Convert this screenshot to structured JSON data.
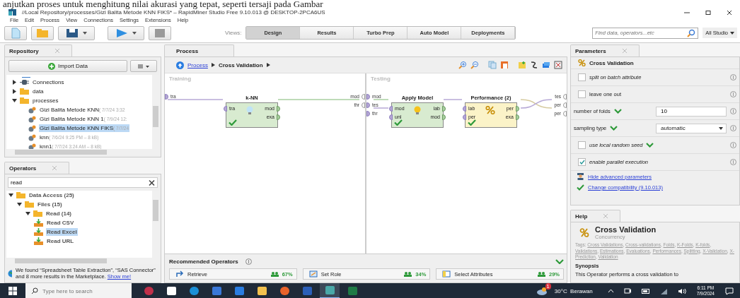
{
  "document_text": "anjutkan proses untuk menghitung nilai akurasi yang tepat, seperti tersaji pada Gambar",
  "window": {
    "title": "//Local Repository/processes/Gizi Balita Metode KNN FIKS* – RapidMiner Studio Free 9.10.013 @ DESKTOP-2PCA6US"
  },
  "menu": [
    "File",
    "Edit",
    "Process",
    "View",
    "Connections",
    "Settings",
    "Extensions",
    "Help"
  ],
  "toolbar": {
    "views_label": "Views:",
    "views": [
      {
        "label": "Design",
        "selected": true
      },
      {
        "label": "Results",
        "selected": false
      },
      {
        "label": "Turbo Prep",
        "selected": false
      },
      {
        "label": "Auto Model",
        "selected": false
      },
      {
        "label": "Deployments",
        "selected": false
      }
    ],
    "search": {
      "placeholder": "Find data, operators...etc"
    },
    "scope": "All Studio"
  },
  "repository": {
    "title": "Repository",
    "import_button": "Import Data",
    "tree": [
      {
        "label": "Connections",
        "kind": "connections",
        "expanded": false,
        "selected": false
      },
      {
        "label": "data",
        "kind": "folder",
        "expanded": false,
        "selected": false
      },
      {
        "label": "processes",
        "kind": "folder",
        "expanded": true,
        "selected": false,
        "children": [
          {
            "label": "Gizi Balita Metode KNN",
            "meta": "( 7/7/24 3:32",
            "kind": "process",
            "selected": false
          },
          {
            "label": "Gizi Balita Metode KNN 1",
            "meta": "( 7/9/24 12:",
            "kind": "process",
            "selected": false
          },
          {
            "label": "Gizi Balita Metode KNN FIKS",
            "meta": "( 7/7/24",
            "kind": "process",
            "selected": true
          },
          {
            "label": "knn",
            "meta": "( 7/6/24 9:25 PM – 8 kB)",
            "kind": "process",
            "selected": false
          },
          {
            "label": "knn1",
            "meta": "( 7/7/24 3:24 AM – 8 kB)",
            "kind": "process",
            "selected": false
          }
        ]
      }
    ]
  },
  "operators": {
    "title": "Operators",
    "search": {
      "value": "read"
    },
    "tree": [
      {
        "label": "Data Access (25)",
        "kind": "folder",
        "expanded": true,
        "selected": false,
        "children": [
          {
            "label": "Files (15)",
            "kind": "folder",
            "expanded": true,
            "selected": false,
            "children": [
              {
                "label": "Read (14)",
                "kind": "folder",
                "expanded": true,
                "selected": false,
                "children": [
                  {
                    "label": "Read CSV",
                    "kind": "operator",
                    "selected": false
                  },
                  {
                    "label": "Read Excel",
                    "kind": "operator",
                    "selected": true
                  },
                  {
                    "label": "Read URL",
                    "kind": "operator",
                    "selected": false
                  }
                ]
              }
            ]
          }
        ]
      }
    ],
    "marketplace_note": "We found “Spreadsheet Table Extraction”, “SAS Connector” and 8 more results in the Marketplace.",
    "marketplace_link": "Show me!"
  },
  "process": {
    "title": "Process",
    "breadcrumb": [
      "Process",
      "Cross Validation"
    ],
    "subprocesses": [
      {
        "title": "Training",
        "inputs": [
          "tra"
        ],
        "outputs": [
          "mod",
          "thr"
        ],
        "nodes": [
          {
            "name": "k-NN",
            "kind": "model",
            "inputs": [
              "tra"
            ],
            "outputs": [
              "mod",
              "exa"
            ]
          }
        ]
      },
      {
        "title": "Testing",
        "inputs": [
          "mod",
          "tes",
          "thr"
        ],
        "outputs": [
          "tes",
          "per",
          "per"
        ],
        "nodes": [
          {
            "name": "Apply Model",
            "kind": "model",
            "inputs": [
              "mod",
              "unl"
            ],
            "outputs": [
              "lab",
              "mod"
            ]
          },
          {
            "name": "Performance (2)",
            "kind": "performance",
            "inputs": [
              "lab",
              "per"
            ],
            "outputs": [
              "per",
              "exa"
            ]
          }
        ]
      }
    ],
    "recommended_title": "Recommended Operators",
    "recommended": [
      {
        "name": "Retrieve",
        "share": "67%",
        "kind": "retrieve"
      },
      {
        "name": "Set Role",
        "share": "34%",
        "kind": "role"
      },
      {
        "name": "Select Attributes",
        "share": "29%",
        "kind": "select"
      }
    ]
  },
  "parameters": {
    "title": "Parameters",
    "operator": "Cross Validation",
    "rows": [
      {
        "label": "split on batch attribute",
        "kind": "checkbox",
        "checked": false,
        "expert": true,
        "marked": false
      },
      {
        "label": "leave one out",
        "kind": "checkbox",
        "checked": false,
        "expert": false,
        "marked": false
      },
      {
        "label": "number of folds",
        "kind": "text",
        "value": "10",
        "expert": false,
        "marked": true
      },
      {
        "label": "sampling type",
        "kind": "select",
        "value": "automatic",
        "expert": false,
        "marked": true
      },
      {
        "label": "use local random seed",
        "kind": "checkbox",
        "checked": false,
        "expert": true,
        "marked": true
      },
      {
        "label": "enable parallel execution",
        "kind": "checkbox",
        "checked": true,
        "expert": true,
        "marked": false
      }
    ],
    "links": [
      {
        "label": "Hide advanced parameters",
        "kind": "advanced"
      },
      {
        "label": "Change compatibility (9.10.013)",
        "kind": "compat"
      }
    ]
  },
  "help": {
    "title": "Help",
    "heading": "Cross Validation",
    "subheading": "Concurrency",
    "tags_label": "Tags:",
    "tags": [
      "Cross Validations",
      "Cross-validations",
      "Folds",
      "K-Folds",
      "K-folds",
      "Validations",
      "Estimations",
      "Evaluations",
      "Performances",
      "Splitting",
      "X-Validation",
      "X-Prediction",
      "Validation"
    ],
    "tag_separator": ", ",
    "synopsis_title": "Synopsis",
    "synopsis": "This Operator performs a cross validation to"
  },
  "taskbar": {
    "search": {
      "placeholder": "Type here to search"
    },
    "apps": [
      {
        "kind": "ball"
      },
      {
        "kind": "taskview"
      },
      {
        "kind": "edge"
      },
      {
        "kind": "store"
      },
      {
        "kind": "mail"
      },
      {
        "kind": "files"
      },
      {
        "kind": "firefox"
      },
      {
        "kind": "word"
      },
      {
        "kind": "rapidminer",
        "selected": true
      },
      {
        "kind": "excel"
      }
    ],
    "weather": "30°C  Berawan",
    "weather_badge": "1",
    "time": "6:11 PM",
    "date": "7/9/2024"
  }
}
